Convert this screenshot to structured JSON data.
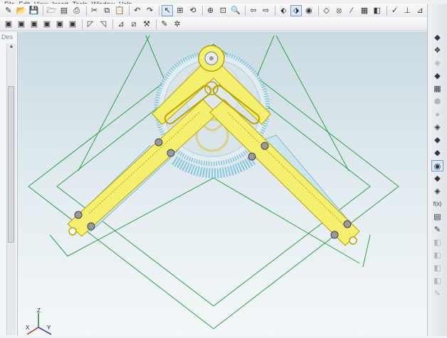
{
  "menubar": {
    "items": [
      "File",
      "Edit",
      "View",
      "Insert",
      "Tools",
      "Window",
      "Help"
    ]
  },
  "toolbar1": [
    {
      "name": "new-icon",
      "glyph": "✎"
    },
    {
      "name": "open-icon",
      "glyph": "📂"
    },
    {
      "name": "save-icon",
      "glyph": "💾"
    },
    {
      "name": "sep"
    },
    {
      "name": "folder-icon",
      "glyph": "🗁"
    },
    {
      "name": "print-preview-icon",
      "glyph": "▤"
    },
    {
      "name": "print-icon",
      "glyph": "⎙"
    },
    {
      "name": "sep"
    },
    {
      "name": "cut-icon",
      "glyph": "✂"
    },
    {
      "name": "copy-icon",
      "glyph": "⧉"
    },
    {
      "name": "paste-icon",
      "glyph": "📋"
    },
    {
      "name": "sep"
    },
    {
      "name": "undo-icon",
      "glyph": "↶"
    },
    {
      "name": "redo-icon",
      "glyph": "↷"
    },
    {
      "name": "sep"
    },
    {
      "name": "select-arrow-icon",
      "glyph": "↖",
      "active": true
    },
    {
      "name": "select-box-icon",
      "glyph": "⊞"
    },
    {
      "name": "rotate-view-icon",
      "glyph": "⟲"
    },
    {
      "name": "sep"
    },
    {
      "name": "zoom-in-icon",
      "glyph": "⊕"
    },
    {
      "name": "zoom-window-icon",
      "glyph": "⊡"
    },
    {
      "name": "zoom-all-icon",
      "glyph": "🔍"
    },
    {
      "name": "sep"
    },
    {
      "name": "previous-view-icon",
      "glyph": "⇦"
    },
    {
      "name": "next-view-icon",
      "glyph": "⇨"
    },
    {
      "name": "sep"
    },
    {
      "name": "pick-filter-icon",
      "glyph": "⬖"
    },
    {
      "name": "pick-mode-icon",
      "glyph": "⬗",
      "active": true
    },
    {
      "name": "render-icon",
      "glyph": "◉"
    },
    {
      "name": "sep"
    },
    {
      "name": "sketch-icon",
      "glyph": "◇"
    },
    {
      "name": "point-icon",
      "glyph": "⦻"
    },
    {
      "name": "line-icon",
      "glyph": "∕"
    },
    {
      "name": "grid-icon",
      "glyph": "▦"
    },
    {
      "name": "feature-icon",
      "glyph": "◧"
    },
    {
      "name": "sep"
    },
    {
      "name": "check-icon",
      "glyph": "✓"
    },
    {
      "name": "measure-icon",
      "glyph": "⊥"
    },
    {
      "name": "ruler-icon",
      "glyph": "⊿"
    }
  ],
  "toolbar2": [
    {
      "name": "view-front-icon",
      "glyph": "▣"
    },
    {
      "name": "view-back-icon",
      "glyph": "▣"
    },
    {
      "name": "view-top-icon",
      "glyph": "▣"
    },
    {
      "name": "view-bottom-icon",
      "glyph": "▣"
    },
    {
      "name": "view-left-icon",
      "glyph": "▣"
    },
    {
      "name": "view-right-icon",
      "glyph": "▣"
    },
    {
      "name": "sep"
    },
    {
      "name": "isometric-icon",
      "glyph": "◸"
    },
    {
      "name": "trimetric-icon",
      "glyph": "◹"
    },
    {
      "name": "sep"
    },
    {
      "name": "section-icon",
      "glyph": "⊿"
    },
    {
      "name": "explode-icon",
      "glyph": "⧄"
    },
    {
      "name": "wrench-icon",
      "glyph": "⚒"
    },
    {
      "name": "sep"
    },
    {
      "name": "tools-icon",
      "glyph": "✎"
    },
    {
      "name": "settings-icon",
      "glyph": "✲"
    }
  ],
  "left_panel": {
    "tab_label": "Des"
  },
  "right_toolbar": [
    {
      "name": "part-icon",
      "glyph": "◆"
    },
    {
      "name": "assembly-icon",
      "glyph": "❖"
    },
    {
      "name": "dim-part-icon",
      "glyph": "◈",
      "dim": true
    },
    {
      "name": "component-icon",
      "glyph": "◆"
    },
    {
      "name": "array-icon",
      "glyph": "▦"
    },
    {
      "name": "box-icon",
      "glyph": "⬢",
      "dim": true
    },
    {
      "name": "sphere-icon",
      "glyph": "●",
      "dim": true
    },
    {
      "name": "color-cube-icon",
      "glyph": "◈"
    },
    {
      "name": "material-icon",
      "glyph": "◆"
    },
    {
      "name": "layer-icon",
      "glyph": "◆"
    },
    {
      "name": "display-icon",
      "glyph": "◉",
      "active": true
    },
    {
      "name": "paint-icon",
      "glyph": "◆"
    },
    {
      "name": "attribute-icon",
      "glyph": "◈"
    },
    {
      "name": "formula-icon",
      "glyph": "f(x)"
    },
    {
      "name": "table-icon",
      "glyph": "▤"
    },
    {
      "name": "brush-icon",
      "glyph": "✎"
    },
    {
      "name": "dim-tool-1-icon",
      "glyph": "◧",
      "dim": true
    },
    {
      "name": "dim-tool-2-icon",
      "glyph": "◧",
      "dim": true
    },
    {
      "name": "dim-tool-3-icon",
      "glyph": "◧",
      "dim": true
    },
    {
      "name": "dim-tool-4-icon",
      "glyph": "◧",
      "dim": true
    },
    {
      "name": "dim-tool-5-icon",
      "glyph": "✎",
      "dim": true
    }
  ],
  "axes": {
    "x_label": "X",
    "y_label": "Y",
    "z_label": "Z"
  },
  "colors": {
    "part_yellow": "#f4ef6e",
    "part_outline": "#b8a400",
    "scale_blue": "#c9e6ef",
    "bounding_green": "#2ea043",
    "protractor_blue": "#86c5dd"
  }
}
